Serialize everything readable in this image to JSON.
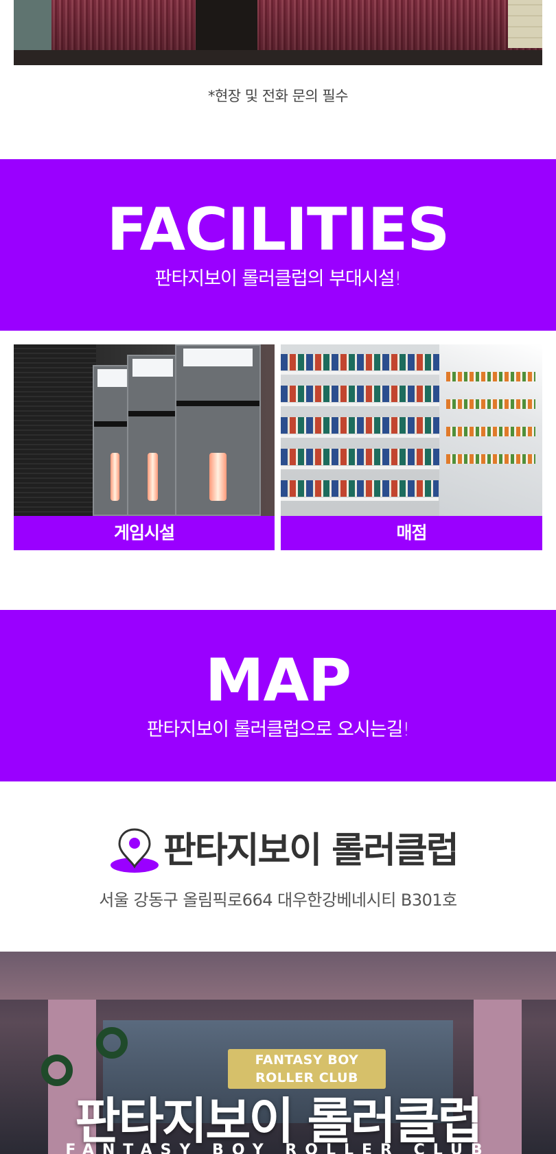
{
  "notice": "*현장 및 전화 문의 필수",
  "facilities": {
    "title": "FACILITIES",
    "subtitle": "판타지보이 롤러클럽의 부대시설!",
    "items": [
      {
        "label": "게임시설"
      },
      {
        "label": "매점"
      }
    ]
  },
  "map": {
    "title": "MAP",
    "subtitle": "판타지보이 롤러클럽으로 오시는길!",
    "location_name": "판타지보이 롤러클럽",
    "address": "서울 강동구 올림픽로664 대우한강베네시티 B301호"
  },
  "hero": {
    "sign_line1": "FANTASY BOY",
    "sign_line2": "ROLLER CLUB",
    "title": "판타지보이 롤러클럽",
    "subtitle": "FANTASY BOY ROLLER CLUB"
  },
  "colors": {
    "accent_purple": "#9a00ff",
    "text_dark": "#333333",
    "text_gray": "#555555"
  },
  "icons": {
    "location": "map-pin-icon"
  }
}
